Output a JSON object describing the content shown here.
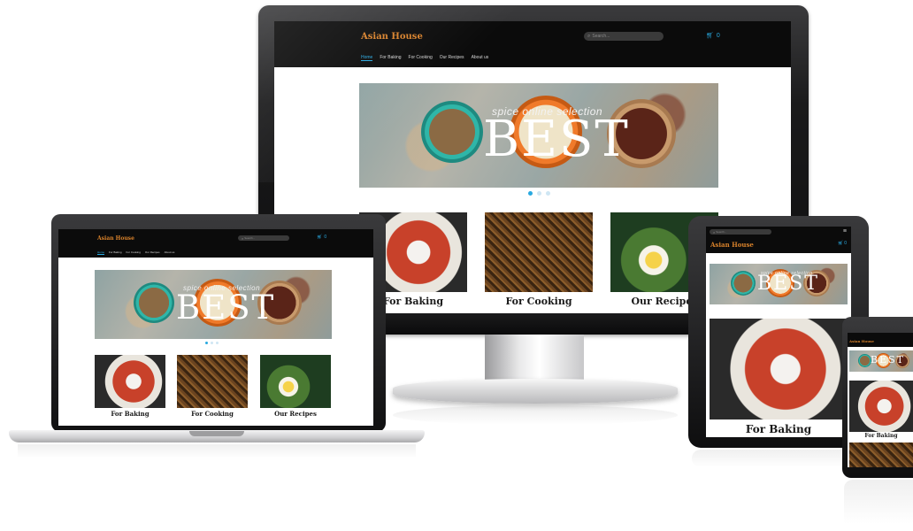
{
  "site": {
    "brand": "Asian House",
    "search_placeholder": "Search...",
    "cart_count": "0",
    "nav": [
      "Home",
      "For Baking",
      "For Cooking",
      "Our Recipes",
      "About us"
    ],
    "banner_small_text": "spice online selection",
    "banner_big_text": "BEST",
    "cards": [
      "For Baking",
      "For Cooking",
      "Our Recipes"
    ]
  },
  "colors": {
    "header_bg": "#0b0b0b",
    "brand": "#d9822b",
    "accent": "#29a9e0"
  },
  "icons": {
    "search": "search-icon",
    "cart": "cart-icon",
    "menu": "hamburger-menu-icon"
  },
  "carousel": {
    "slides": 3,
    "active_index": 0
  }
}
